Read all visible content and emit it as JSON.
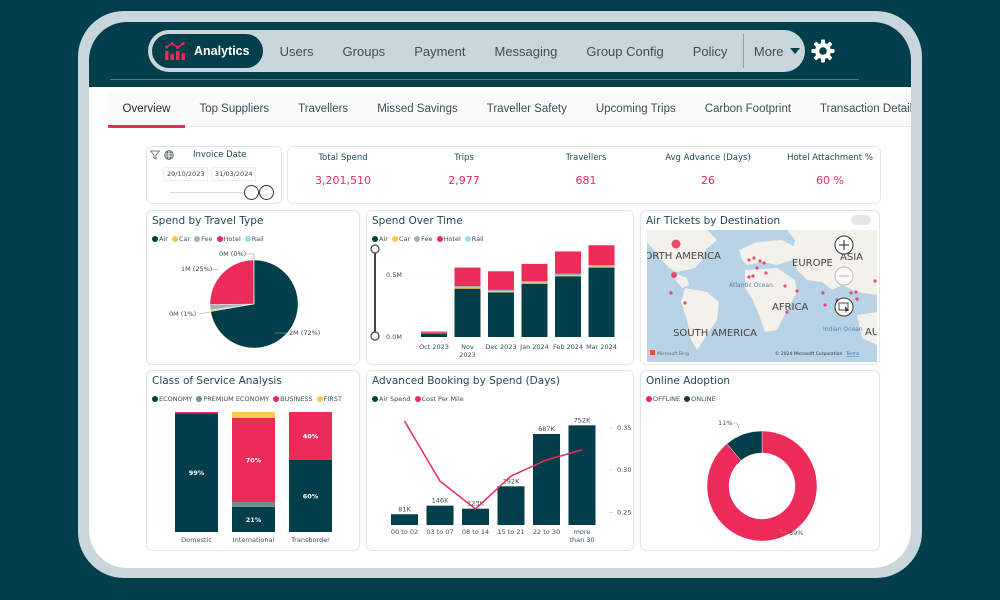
{
  "nav": {
    "active": "Analytics",
    "items": [
      "Users",
      "Groups",
      "Payment",
      "Messaging",
      "Group Config",
      "Policy"
    ],
    "more": "More"
  },
  "tabs": [
    "Overview",
    "Top Suppliers",
    "Travellers",
    "Missed Savings",
    "Traveller Safety",
    "Upcoming Trips",
    "Carbon Footprint",
    "Transaction Detail"
  ],
  "active_tab": "Overview",
  "filter": {
    "label": "Invoice Date",
    "start": "29/10/2023",
    "end": "31/03/2024"
  },
  "kpis": [
    {
      "label": "Total Spend",
      "value": "3,201,510"
    },
    {
      "label": "Trips",
      "value": "2,977"
    },
    {
      "label": "Travellers",
      "value": "681"
    },
    {
      "label": "Avg Advance (Days)",
      "value": "26"
    },
    {
      "label": "Hotel Attachment %",
      "value": "60 %"
    }
  ],
  "colors": {
    "air": "#023f4a",
    "car": "#f9c84c",
    "fee": "#9fb3b9",
    "hotel": "#ec2b59",
    "rail": "#9fdcf0",
    "premium": "#6e8e96",
    "accent": "#ec2b59"
  },
  "map": {
    "title": "Air Tickets by Destination",
    "labels": [
      "NORTH AMERICA",
      "EUROPE",
      "ASIA",
      "AFRICA",
      "SOUTH AMERICA",
      "Atlantic Ocean",
      "Indian Ocean",
      "AU"
    ],
    "attribution": "© 2024 Microsoft Corporation",
    "terms": "Terms",
    "provider": "Microsoft Bing"
  },
  "chart_data": [
    {
      "type": "pie",
      "title": "Spend by Travel Type",
      "legend": [
        "Air",
        "Car",
        "Fee",
        "Hotel",
        "Rail"
      ],
      "slices": [
        {
          "name": "Air",
          "value": 72,
          "label": "2M (72%)"
        },
        {
          "name": "Car",
          "value": 0.5,
          "label": "0M (1%)"
        },
        {
          "name": "Fee",
          "value": 2,
          "label": ""
        },
        {
          "name": "Hotel",
          "value": 25,
          "label": "1M (25%)"
        },
        {
          "name": "Rail",
          "value": 0.1,
          "label": "0M (0%)"
        }
      ]
    },
    {
      "type": "bar",
      "stacked": true,
      "title": "Spend Over Time",
      "legend": [
        "Air",
        "Car",
        "Fee",
        "Hotel",
        "Rail"
      ],
      "categories": [
        "Oct 2023",
        "Nov 2023",
        "Dec 2023",
        "Jan 2024",
        "Feb 2024",
        "Mar 2024"
      ],
      "series": [
        {
          "name": "Air",
          "values": [
            0.03,
            0.39,
            0.36,
            0.43,
            0.49,
            0.56
          ]
        },
        {
          "name": "Car",
          "values": [
            0.002,
            0.01,
            0.01,
            0.01,
            0.01,
            0.01
          ]
        },
        {
          "name": "Fee",
          "values": [
            0.002,
            0.01,
            0.01,
            0.01,
            0.01,
            0.01
          ]
        },
        {
          "name": "Hotel",
          "values": [
            0.01,
            0.15,
            0.15,
            0.14,
            0.18,
            0.16
          ]
        },
        {
          "name": "Rail",
          "values": [
            0,
            0,
            0,
            0,
            0,
            0
          ]
        }
      ],
      "yticks": [
        "0.0M",
        "0.5M"
      ],
      "ylim": [
        0,
        0.75
      ]
    },
    {
      "type": "bar",
      "stacked": true,
      "percent": true,
      "title": "Class of Service Analysis",
      "legend": [
        "ECONOMY",
        "PREMIUM ECONOMY",
        "BUSINESS",
        "FIRST"
      ],
      "categories": [
        "Domestic",
        "International",
        "Transborder"
      ],
      "series": [
        {
          "name": "ECONOMY",
          "values": [
            99,
            21,
            60
          ]
        },
        {
          "name": "PREMIUM ECONOMY",
          "values": [
            0,
            4,
            0
          ]
        },
        {
          "name": "BUSINESS",
          "values": [
            1,
            70,
            40
          ]
        },
        {
          "name": "FIRST",
          "values": [
            0,
            5,
            0
          ]
        }
      ],
      "data_labels": [
        [
          "99%",
          "",
          "",
          ""
        ],
        [
          "21%",
          "",
          "70%",
          ""
        ],
        [
          "60%",
          "",
          "40%",
          ""
        ]
      ]
    },
    {
      "type": "bar",
      "combo": "line",
      "title": "Advanced Booking by Spend (Days)",
      "legend": [
        "Air Spend",
        "Cost Per Mile"
      ],
      "categories": [
        "00 to 02",
        "03 to 07",
        "08 to 14",
        "15 to 21",
        "22 to 30",
        "more than 30"
      ],
      "bars": {
        "name": "Air Spend",
        "values": [
          81,
          146,
          123,
          292,
          687,
          752
        ],
        "labels": [
          "81K",
          "146K",
          "123K",
          "292K",
          "687K",
          "752K"
        ]
      },
      "line": {
        "name": "Cost Per Mile",
        "values": [
          0.358,
          0.287,
          0.254,
          0.293,
          0.312,
          0.324
        ]
      },
      "y2ticks": [
        "0.25",
        "0.30",
        "0.35"
      ],
      "y2lim": [
        0.235,
        0.37
      ]
    },
    {
      "type": "pie",
      "donut": true,
      "title": "Online Adoption",
      "legend": [
        "OFFLINE",
        "ONLINE"
      ],
      "slices": [
        {
          "name": "OFFLINE",
          "value": 89,
          "label": "89%"
        },
        {
          "name": "ONLINE",
          "value": 11,
          "label": "11%"
        }
      ]
    }
  ]
}
